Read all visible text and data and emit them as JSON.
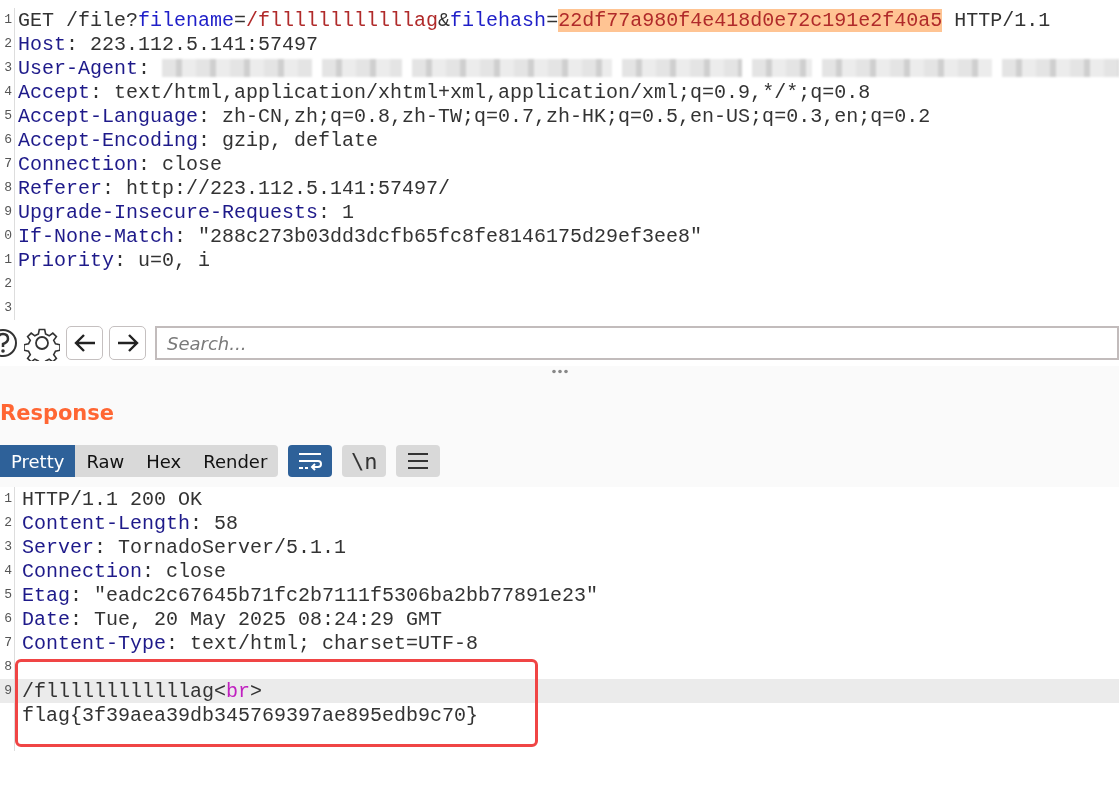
{
  "request": {
    "lines": [
      {
        "number": "1",
        "tokens": [
          {
            "kind": "text",
            "text": "GET /file?"
          },
          {
            "kind": "param",
            "text": "filename"
          },
          {
            "kind": "text",
            "text": "="
          },
          {
            "kind": "value",
            "text": "/fllllllllllllag"
          },
          {
            "kind": "text",
            "text": "&"
          },
          {
            "kind": "param",
            "text": "filehash"
          },
          {
            "kind": "text",
            "text": "="
          },
          {
            "kind": "hash",
            "text": "22df77a980f4e418d0e72c191e2f40a5"
          },
          {
            "kind": "text",
            "text": " HTTP/1.1"
          }
        ]
      },
      {
        "number": "2",
        "tokens": [
          {
            "kind": "header",
            "text": "Host"
          },
          {
            "kind": "text",
            "text": ": 223.112.5.141:57497"
          }
        ]
      },
      {
        "number": "3",
        "tokens": [
          {
            "kind": "header",
            "text": "User-Agent"
          },
          {
            "kind": "text",
            "text": ": "
          },
          {
            "kind": "redacted"
          }
        ]
      },
      {
        "number": "4",
        "tokens": [
          {
            "kind": "header",
            "text": "Accept"
          },
          {
            "kind": "text",
            "text": ": text/html,application/xhtml+xml,application/xml;q=0.9,*/*;q=0.8"
          }
        ]
      },
      {
        "number": "5",
        "tokens": [
          {
            "kind": "header",
            "text": "Accept-Language"
          },
          {
            "kind": "text",
            "text": ": zh-CN,zh;q=0.8,zh-TW;q=0.7,zh-HK;q=0.5,en-US;q=0.3,en;q=0.2"
          }
        ]
      },
      {
        "number": "6",
        "tokens": [
          {
            "kind": "header",
            "text": "Accept-Encoding"
          },
          {
            "kind": "text",
            "text": ": gzip, deflate"
          }
        ]
      },
      {
        "number": "7",
        "tokens": [
          {
            "kind": "header",
            "text": "Connection"
          },
          {
            "kind": "text",
            "text": ": close"
          }
        ]
      },
      {
        "number": "8",
        "tokens": [
          {
            "kind": "header",
            "text": "Referer"
          },
          {
            "kind": "text",
            "text": ": http://223.112.5.141:57497/"
          }
        ]
      },
      {
        "number": "9",
        "tokens": [
          {
            "kind": "header",
            "text": "Upgrade-Insecure-Requests"
          },
          {
            "kind": "text",
            "text": ": 1"
          }
        ]
      },
      {
        "number": "0",
        "tokens": [
          {
            "kind": "header",
            "text": "If-None-Match"
          },
          {
            "kind": "text",
            "text": ": \"288c273b03dd3dcfb65fc8fe8146175d29ef3ee8\""
          }
        ]
      },
      {
        "number": "1",
        "tokens": [
          {
            "kind": "header",
            "text": "Priority"
          },
          {
            "kind": "text",
            "text": ": u=0, i"
          }
        ]
      },
      {
        "number": "2"
      },
      {
        "number": "3"
      }
    ]
  },
  "toolbar": {
    "search": {
      "placeholder": "Search..."
    }
  },
  "response": {
    "title": "Response",
    "tabs": [
      {
        "label": "Pretty",
        "selected": true
      },
      {
        "label": "Raw",
        "selected": false
      },
      {
        "label": "Hex",
        "selected": false
      },
      {
        "label": "Render",
        "selected": false
      }
    ],
    "toggles": [
      {
        "kind": "wrap",
        "on": true
      },
      {
        "kind": "newline",
        "label": "\\n",
        "on": false
      },
      {
        "kind": "menu",
        "on": false
      }
    ],
    "lines": [
      {
        "number": "1",
        "selected": false,
        "tokens": [
          {
            "kind": "text",
            "text": "HTTP/1.1 200 OK"
          }
        ]
      },
      {
        "number": "2",
        "selected": false,
        "tokens": [
          {
            "kind": "header",
            "text": "Content-Length"
          },
          {
            "kind": "text",
            "text": ": 58"
          }
        ]
      },
      {
        "number": "3",
        "selected": false,
        "tokens": [
          {
            "kind": "header",
            "text": "Server"
          },
          {
            "kind": "text",
            "text": ": TornadoServer/5.1.1"
          }
        ]
      },
      {
        "number": "4",
        "selected": false,
        "tokens": [
          {
            "kind": "header",
            "text": "Connection"
          },
          {
            "kind": "text",
            "text": ": close"
          }
        ]
      },
      {
        "number": "5",
        "selected": false,
        "tokens": [
          {
            "kind": "header",
            "text": "Etag"
          },
          {
            "kind": "text",
            "text": ": \"eadc2c67645b71fc2b7111f5306ba2bb77891e23\""
          }
        ]
      },
      {
        "number": "6",
        "selected": false,
        "tokens": [
          {
            "kind": "header",
            "text": "Date"
          },
          {
            "kind": "text",
            "text": ": Tue, 20 May 2025 08:24:29 GMT"
          }
        ]
      },
      {
        "number": "7",
        "selected": false,
        "tokens": [
          {
            "kind": "header",
            "text": "Content-Type"
          },
          {
            "kind": "text",
            "text": ": text/html; charset=UTF-8"
          }
        ]
      },
      {
        "number": "8",
        "selected": false
      },
      {
        "number": "9",
        "selected": true,
        "tokens": [
          {
            "kind": "text",
            "text": "/fllllllllllllag"
          },
          {
            "kind": "punct",
            "text": "<"
          },
          {
            "kind": "tag",
            "text": "br"
          },
          {
            "kind": "punct",
            "text": ">"
          }
        ]
      },
      {
        "selected": false,
        "tokens": [
          {
            "kind": "text",
            "text": "flag{3f39aea39db345769397ae895edb9c70}"
          }
        ]
      },
      {
        "selected": false
      }
    ]
  }
}
